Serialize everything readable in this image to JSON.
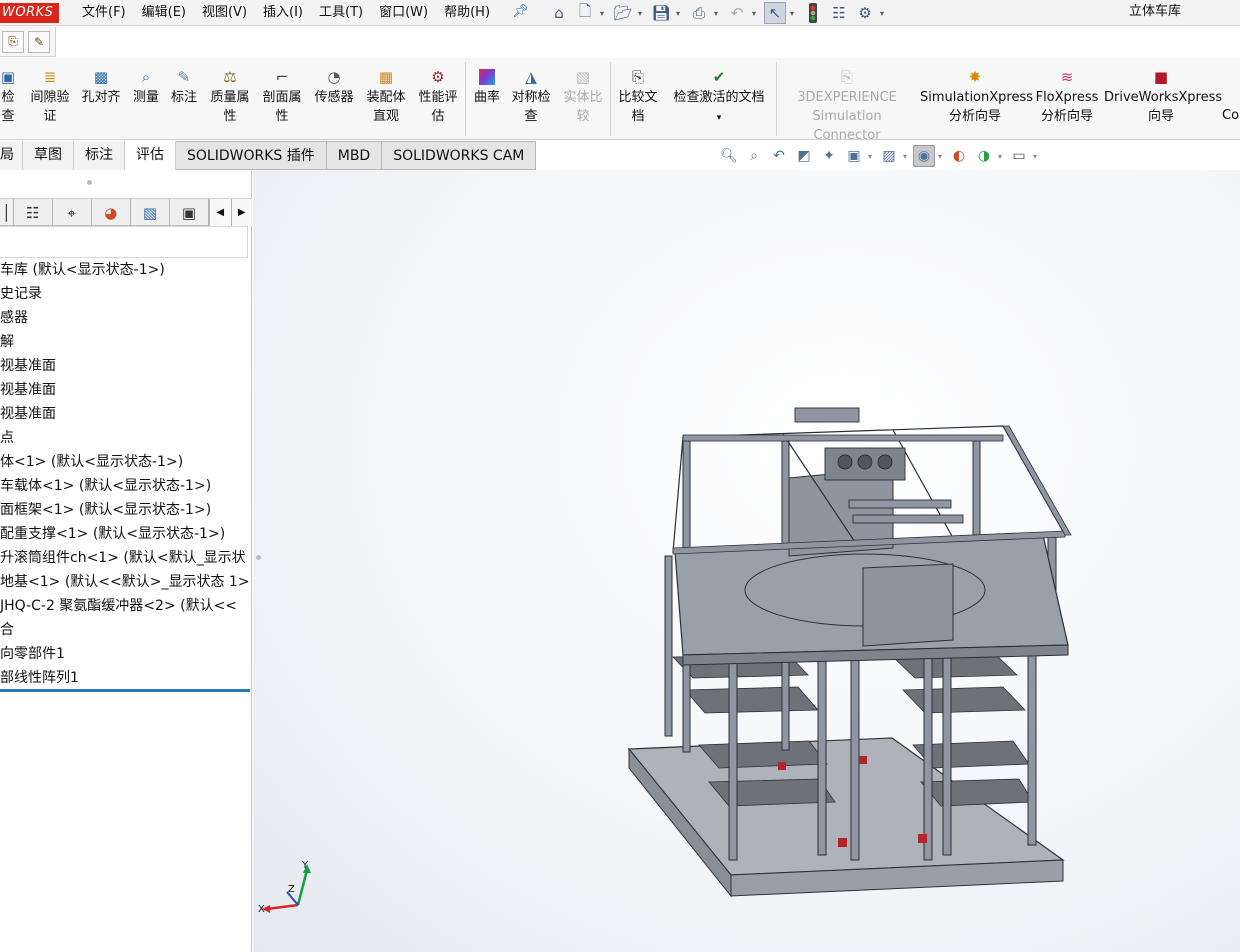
{
  "app": {
    "logo_text": "WORKS",
    "document_title": "立体车库",
    "menu": [
      "文件(F)",
      "编辑(E)",
      "视图(V)",
      "插入(I)",
      "工具(T)",
      "窗口(W)",
      "帮助(H)"
    ]
  },
  "ribbon": {
    "buttons": [
      {
        "line1": "检",
        "line2": "查",
        "icon": "interference-check-icon"
      },
      {
        "line1": "间隙验",
        "line2": "证",
        "icon": "clearance-verification-icon"
      },
      {
        "line1": "孔对齐",
        "line2": "",
        "icon": "hole-alignment-icon"
      },
      {
        "line1": "测量",
        "line2": "",
        "icon": "measure-icon"
      },
      {
        "line1": "标注",
        "line2": "",
        "icon": "markup-icon"
      },
      {
        "line1": "质量属",
        "line2": "性",
        "icon": "mass-properties-icon"
      },
      {
        "line1": "剖面属",
        "line2": "性",
        "icon": "section-properties-icon"
      },
      {
        "line1": "传感器",
        "line2": "",
        "icon": "sensor-icon"
      },
      {
        "line1": "装配体",
        "line2": "直观",
        "icon": "assembly-visualization-icon"
      },
      {
        "line1": "性能评",
        "line2": "估",
        "icon": "performance-evaluation-icon"
      },
      {
        "line1": "曲率",
        "line2": "",
        "icon": "curvature-icon"
      },
      {
        "line1": "对称检",
        "line2": "查",
        "icon": "symmetry-check-icon"
      },
      {
        "line1": "实体比",
        "line2": "较",
        "icon": "compare-bodies-icon"
      },
      {
        "line1": "比较文",
        "line2": "档",
        "icon": "compare-documents-icon"
      },
      {
        "line1": "检查激活的文档",
        "line2": "",
        "icon": "check-active-document-icon"
      },
      {
        "line1": "3DEXPERIENCE",
        "line2": "Simulation Connector",
        "icon": "3dexperience-icon"
      },
      {
        "line1": "SimulationXpress",
        "line2": "分析向导",
        "icon": "simulationxpress-icon"
      },
      {
        "line1": "FloXpress",
        "line2": "分析向导",
        "icon": "floxpress-icon"
      },
      {
        "line1": "DriveWorksXpress",
        "line2": "向导",
        "icon": "driveworksxpress-icon"
      },
      {
        "line1": "Co",
        "line2": "",
        "icon": "costing-icon"
      }
    ]
  },
  "tabs": [
    "局",
    "草图",
    "标注",
    "评估",
    "SOLIDWORKS 插件",
    "MBD",
    "SOLIDWORKS CAM"
  ],
  "active_tab": "评估",
  "feature_tree": [
    "车库  (默认<显示状态-1>)",
    "史记录",
    "感器",
    "解",
    "视基准面",
    "视基准面",
    "视基准面",
    "点",
    "体<1> (默认<显示状态-1>)",
    "车载体<1> (默认<显示状态-1>)",
    "面框架<1> (默认<显示状态-1>)",
    "配重支撑<1> (默认<显示状态-1>)",
    "升滚筒组件ch<1> (默认<默认_显示状",
    "地基<1> (默认<<默认>_显示状态 1>",
    "JHQ-C-2 聚氨酯缓冲器<2> (默认<<",
    "合",
    "向零部件1",
    "部线性阵列1"
  ],
  "triad": {
    "x": "X",
    "y": "Y",
    "z": "Z"
  },
  "colors": {
    "accent": "#2b78b7",
    "logo": "#d9261c",
    "frame": "#8c94a0",
    "base": "#a9adb6"
  }
}
